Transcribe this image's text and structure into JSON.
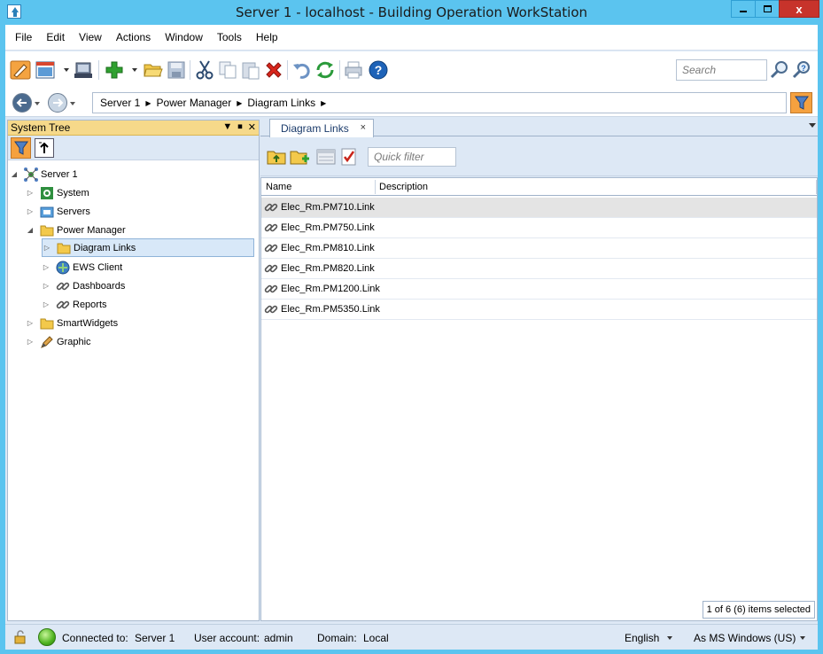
{
  "window": {
    "title": "Server 1 - localhost - Building Operation WorkStation",
    "close_glyph": "x"
  },
  "menu": [
    "File",
    "Edit",
    "View",
    "Actions",
    "Window",
    "Tools",
    "Help"
  ],
  "toolbar": {
    "search_placeholder": "Search"
  },
  "address": {
    "crumbs": [
      "Server 1",
      "Power Manager",
      "Diagram Links"
    ]
  },
  "system_tree": {
    "title": "System Tree",
    "nodes": [
      {
        "label": "Server 1",
        "icon": "server-network-icon",
        "expanded": true
      },
      {
        "label": "System",
        "icon": "system-gear-icon",
        "expanded": false
      },
      {
        "label": "Servers",
        "icon": "servers-folder-icon",
        "expanded": false
      },
      {
        "label": "Power Manager",
        "icon": "folder-icon",
        "expanded": true
      },
      {
        "label": "Diagram Links",
        "icon": "folder-icon",
        "expanded": false,
        "selected": true
      },
      {
        "label": "EWS Client",
        "icon": "ews-client-icon",
        "expanded": false
      },
      {
        "label": "Dashboards",
        "icon": "link-icon",
        "expanded": false
      },
      {
        "label": "Reports",
        "icon": "link-icon",
        "expanded": false
      },
      {
        "label": "SmartWidgets",
        "icon": "folder-icon",
        "expanded": false
      },
      {
        "label": "Graphic",
        "icon": "graphic-pen-icon",
        "expanded": false
      }
    ]
  },
  "tab": {
    "label": "Diagram Links",
    "close": "×"
  },
  "content": {
    "quick_filter_placeholder": "Quick filter",
    "columns": [
      "Name",
      "Description"
    ],
    "rows": [
      {
        "name": "Elec_Rm.PM710.Link",
        "description": ""
      },
      {
        "name": "Elec_Rm.PM750.Link",
        "description": ""
      },
      {
        "name": "Elec_Rm.PM810.Link",
        "description": ""
      },
      {
        "name": "Elec_Rm.PM820.Link",
        "description": ""
      },
      {
        "name": "Elec_Rm.PM1200.Link",
        "description": ""
      },
      {
        "name": "Elec_Rm.PM5350.Link",
        "description": ""
      }
    ],
    "selection_status": "1 of 6 (6) items selected"
  },
  "status": {
    "connected_label": "Connected to:",
    "connected_value": "Server 1",
    "user_label": "User account:",
    "user_value": "admin",
    "domain_label": "Domain:",
    "domain_value": "Local",
    "language": "English",
    "format": "As MS Windows (US)"
  }
}
